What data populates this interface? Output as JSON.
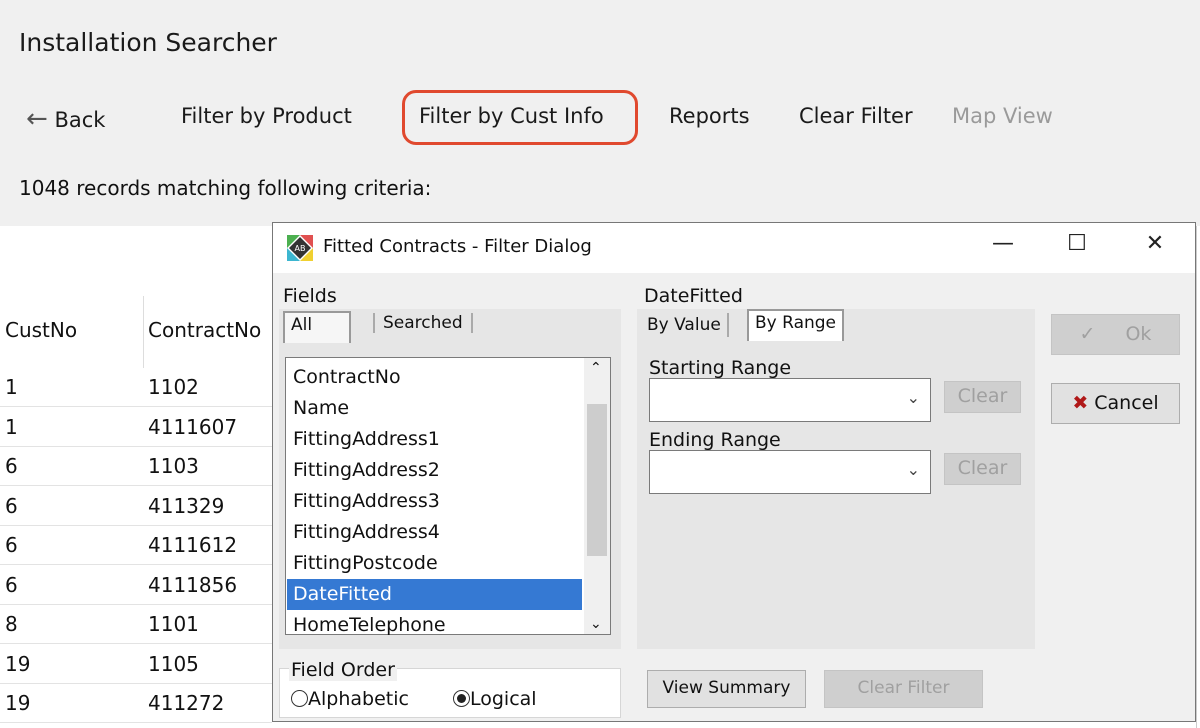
{
  "app": {
    "title": "Installation Searcher"
  },
  "toolbar": {
    "back": "Back",
    "filter_product": "Filter by Product",
    "filter_cust": "Filter by Cust Info",
    "reports": "Reports",
    "clear_filter": "Clear Filter",
    "map_view": "Map View",
    "highlight_color": "#e0492e"
  },
  "status": {
    "records": "1048 records matching following criteria:"
  },
  "table": {
    "headers": [
      "CustNo",
      "ContractNo"
    ],
    "rows": [
      [
        "1",
        "1102"
      ],
      [
        "1",
        "4111607"
      ],
      [
        "6",
        "1103"
      ],
      [
        "6",
        "411329"
      ],
      [
        "6",
        "4111612"
      ],
      [
        "6",
        "4111856"
      ],
      [
        "8",
        "1101"
      ],
      [
        "19",
        "1105"
      ],
      [
        "19",
        "411272"
      ]
    ]
  },
  "dialog": {
    "title": "Fitted Contracts - Filter Dialog",
    "fields_label": "Fields",
    "tabs": [
      "All",
      "Searched"
    ],
    "fields": [
      "ContractNo",
      "Name",
      "FittingAddress1",
      "FittingAddress2",
      "FittingAddress3",
      "FittingAddress4",
      "FittingPostcode",
      "DateFitted",
      "HomeTelephone"
    ],
    "selected_field": "DateFitted",
    "field_panel_title": "DateFitted",
    "range_tabs": [
      "By Value",
      "By Range"
    ],
    "starting_range": "Starting Range",
    "ending_range": "Ending Range",
    "clear": "Clear",
    "ok": "Ok",
    "cancel": "Cancel",
    "field_order": "Field Order",
    "alphabetic": "Alphabetic",
    "logical": "Logical",
    "view_summary": "View Summary",
    "clear_filter": "Clear Filter",
    "selection_color": "#3579d3"
  }
}
